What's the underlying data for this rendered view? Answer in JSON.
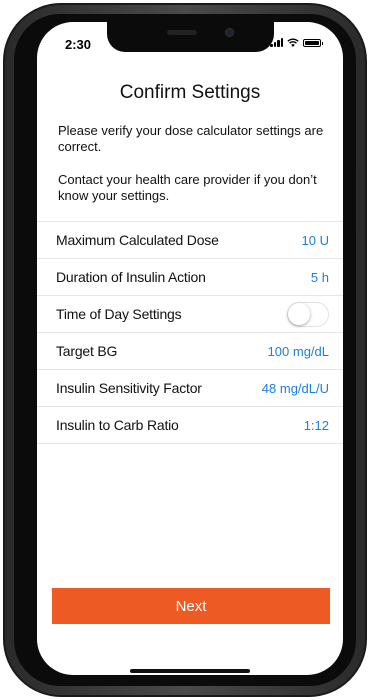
{
  "status_bar": {
    "time": "2:30",
    "icons": [
      "signal-icon",
      "wifi-icon",
      "battery-icon"
    ]
  },
  "screen": {
    "title": "Confirm Settings",
    "instructions": [
      "Please verify your dose calculator settings are correct.",
      "Contact your health care provider if you don’t know your settings."
    ]
  },
  "settings": [
    {
      "label": "Maximum Calculated Dose",
      "value": "10 U"
    },
    {
      "label": "Duration of Insulin Action",
      "value": "5 h"
    },
    {
      "label": "Time of Day Settings",
      "toggle": false
    },
    {
      "label": "Target BG",
      "value": "100 mg/dL"
    },
    {
      "label": "Insulin Sensitivity Factor",
      "value": "48 mg/dL/U"
    },
    {
      "label": "Insulin to Carb Ratio",
      "value": "1:12"
    }
  ],
  "actions": {
    "next_label": "Next"
  },
  "colors": {
    "accent_button": "#ee5a24",
    "value_text": "#1a7fe0",
    "divider": "#e6e6e6"
  }
}
